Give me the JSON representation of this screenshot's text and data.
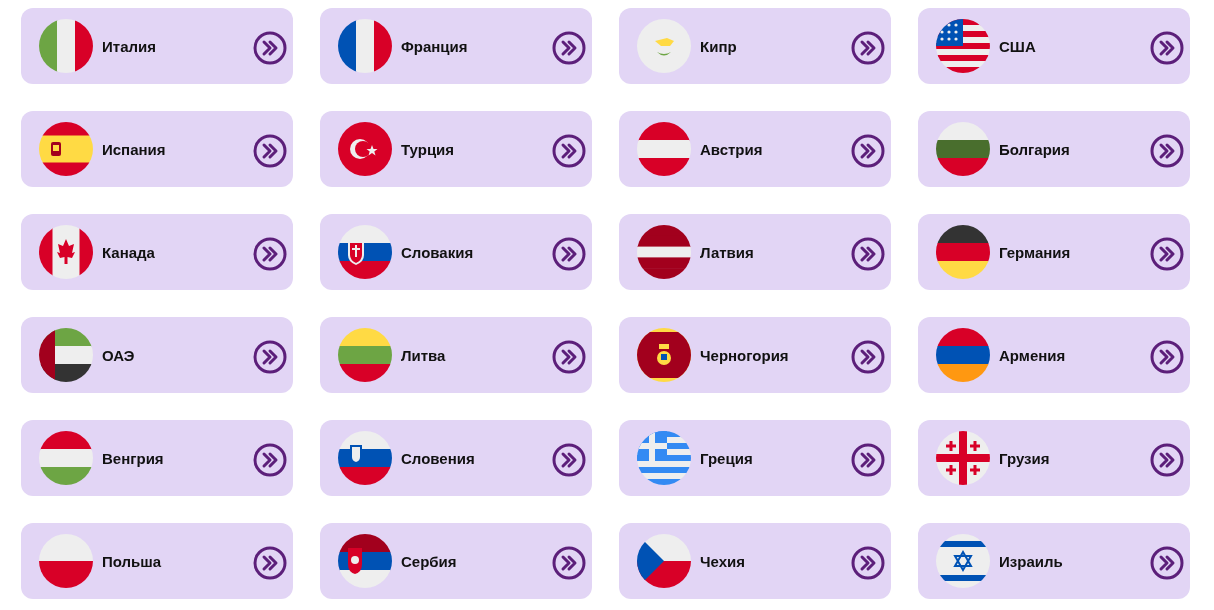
{
  "countries": [
    {
      "name": "Италия",
      "kind": "italy"
    },
    {
      "name": "Франция",
      "kind": "france"
    },
    {
      "name": "Кипр",
      "kind": "cyprus"
    },
    {
      "name": "США",
      "kind": "usa"
    },
    {
      "name": "Испания",
      "kind": "spain"
    },
    {
      "name": "Турция",
      "kind": "turkey"
    },
    {
      "name": "Австрия",
      "kind": "austria"
    },
    {
      "name": "Болгария",
      "kind": "bulgaria"
    },
    {
      "name": "Канада",
      "kind": "canada"
    },
    {
      "name": "Словакия",
      "kind": "slovakia"
    },
    {
      "name": "Латвия",
      "kind": "latvia"
    },
    {
      "name": "Германия",
      "kind": "germany"
    },
    {
      "name": "ОАЭ",
      "kind": "uae"
    },
    {
      "name": "Литва",
      "kind": "lithuania"
    },
    {
      "name": "Черногория",
      "kind": "montenegro"
    },
    {
      "name": "Армения",
      "kind": "armenia"
    },
    {
      "name": "Венгрия",
      "kind": "hungary"
    },
    {
      "name": "Словения",
      "kind": "slovenia"
    },
    {
      "name": "Греция",
      "kind": "greece"
    },
    {
      "name": "Грузия",
      "kind": "georgia"
    },
    {
      "name": "Польша",
      "kind": "poland"
    },
    {
      "name": "Сербия",
      "kind": "serbia"
    },
    {
      "name": "Чехия",
      "kind": "czech"
    },
    {
      "name": "Израиль",
      "kind": "israel"
    }
  ]
}
